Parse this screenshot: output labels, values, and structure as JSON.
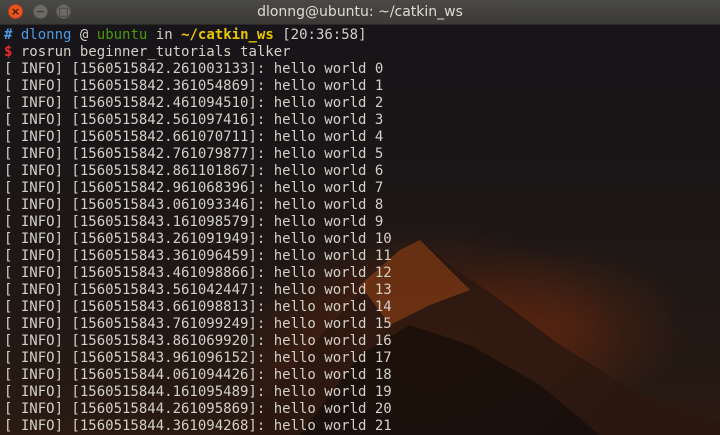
{
  "window": {
    "title": "dlonng@ubuntu: ~/catkin_ws",
    "close_glyph": "×",
    "minimize_glyph": "−",
    "maximize_glyph": "□"
  },
  "prompt": {
    "hash": "#",
    "user": "dlonng",
    "at": "@",
    "host": "ubuntu",
    "in_word": "in",
    "dir": "~/catkin_ws",
    "time": "[20:36:58]",
    "dollar": "$",
    "command": "rosrun beginner_tutorials talker"
  },
  "log_lines": [
    "[ INFO] [1560515842.261003133]: hello world 0",
    "[ INFO] [1560515842.361054869]: hello world 1",
    "[ INFO] [1560515842.461094510]: hello world 2",
    "[ INFO] [1560515842.561097416]: hello world 3",
    "[ INFO] [1560515842.661070711]: hello world 4",
    "[ INFO] [1560515842.761079877]: hello world 5",
    "[ INFO] [1560515842.861101867]: hello world 6",
    "[ INFO] [1560515842.961068396]: hello world 7",
    "[ INFO] [1560515843.061093346]: hello world 8",
    "[ INFO] [1560515843.161098579]: hello world 9",
    "[ INFO] [1560515843.261091949]: hello world 10",
    "[ INFO] [1560515843.361096459]: hello world 11",
    "[ INFO] [1560515843.461098866]: hello world 12",
    "[ INFO] [1560515843.561042447]: hello world 13",
    "[ INFO] [1560515843.661098813]: hello world 14",
    "[ INFO] [1560515843.761099249]: hello world 15",
    "[ INFO] [1560515843.861069920]: hello world 16",
    "[ INFO] [1560515843.961096152]: hello world 17",
    "[ INFO] [1560515844.061094426]: hello world 18",
    "[ INFO] [1560515844.161095489]: hello world 19",
    "[ INFO] [1560515844.261095869]: hello world 20",
    "[ INFO] [1560515844.361094268]: hello world 21"
  ],
  "icons": {
    "close": "close-icon",
    "minimize": "minimize-icon",
    "maximize": "maximize-icon"
  },
  "colors": {
    "prompt_blue": "#4e9ae0",
    "host_green": "#4e9a06",
    "dir_yellow": "#e9c800",
    "dollar_red": "#ef2929",
    "text": "#d3d0c8",
    "close_orange": "#e9541f"
  }
}
